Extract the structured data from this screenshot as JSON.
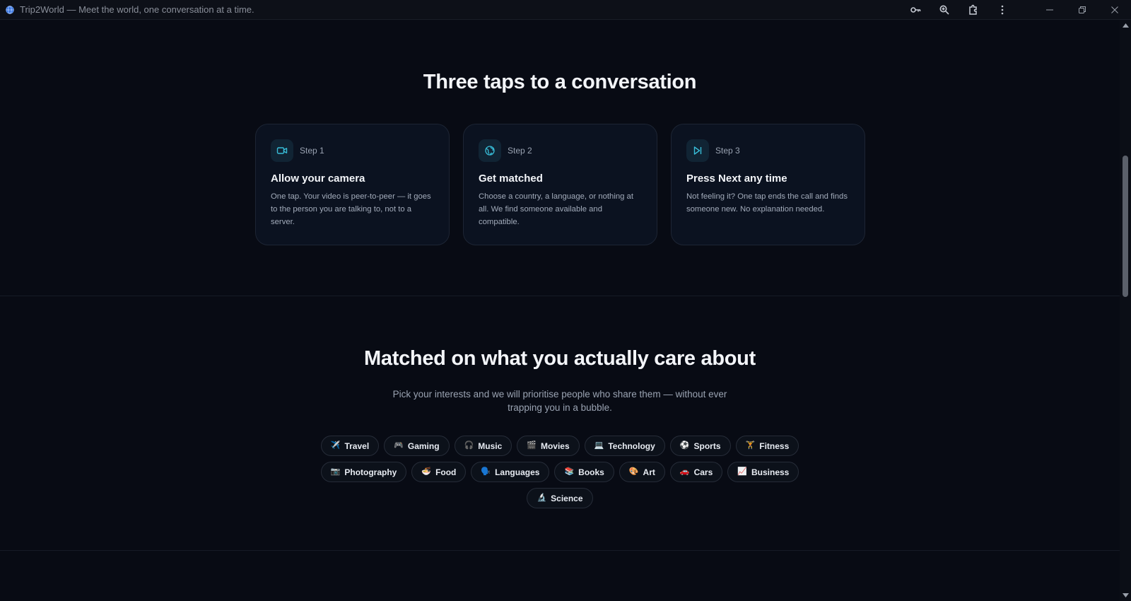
{
  "window": {
    "title": "Trip2World — Meet the world, one conversation at a time."
  },
  "toolbar_icons": [
    "key-icon",
    "zoom-icon",
    "extensions-icon",
    "menu-icon"
  ],
  "window_controls": [
    "minimize-icon",
    "restore-icon",
    "close-icon"
  ],
  "steps_section": {
    "heading": "Three taps to a conversation",
    "steps": [
      {
        "label": "Step 1",
        "title": "Allow your camera",
        "desc": "One tap. Your video is peer-to-peer — it goes to the person you are talking to, not to a server.",
        "icon": "video-camera-icon"
      },
      {
        "label": "Step 2",
        "title": "Get matched",
        "desc": "Choose a country, a language, or nothing at all. We find someone available and compatible.",
        "icon": "globe-icon"
      },
      {
        "label": "Step 3",
        "title": "Press Next any time",
        "desc": "Not feeling it? One tap ends the call and finds someone new. No explanation needed.",
        "icon": "skip-forward-icon"
      }
    ]
  },
  "interests_section": {
    "heading": "Matched on what you actually care about",
    "subtitle": "Pick your interests and we will prioritise people who share them — without ever trapping you in a bubble.",
    "rows": [
      [
        {
          "emoji": "✈️",
          "label": "Travel"
        },
        {
          "emoji": "🎮",
          "label": "Gaming"
        },
        {
          "emoji": "🎧",
          "label": "Music"
        },
        {
          "emoji": "🎬",
          "label": "Movies"
        },
        {
          "emoji": "💻",
          "label": "Technology"
        },
        {
          "emoji": "⚽",
          "label": "Sports"
        },
        {
          "emoji": "🏋️",
          "label": "Fitness"
        }
      ],
      [
        {
          "emoji": "📷",
          "label": "Photography"
        },
        {
          "emoji": "🍜",
          "label": "Food"
        },
        {
          "emoji": "🗣️",
          "label": "Languages"
        },
        {
          "emoji": "📚",
          "label": "Books"
        },
        {
          "emoji": "🎨",
          "label": "Art"
        },
        {
          "emoji": "🚗",
          "label": "Cars"
        },
        {
          "emoji": "📈",
          "label": "Business"
        }
      ],
      [
        {
          "emoji": "🔬",
          "label": "Science"
        }
      ]
    ]
  },
  "colors": {
    "background": "#080b14",
    "card": "#0b1220",
    "accent": "#38bdd8"
  }
}
